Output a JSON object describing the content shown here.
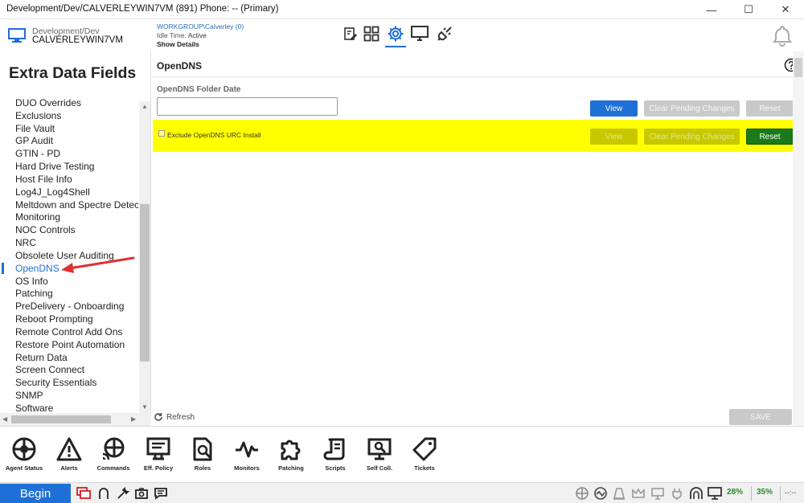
{
  "window": {
    "title": "Development/Dev/CALVERLEYWIN7VM (891) Phone: -- (Primary)",
    "minimize": "—",
    "maximize": "☐",
    "close": "✕"
  },
  "header": {
    "device_path": "Development/Dev",
    "device_name": "CALVERLEYWIN7VM",
    "workgroup": "WORKGROUP\\Calverley (0)",
    "idle_label": "Idle Time:",
    "idle_value": "Active",
    "show_details": "Show Details",
    "toolbar_icons": [
      "edit-list-icon",
      "grid-icon",
      "gear-icon",
      "monitor-icon",
      "plug-icon"
    ],
    "active_tool": "gear-icon"
  },
  "left_panel": {
    "heading": "Extra Data Fields",
    "items": [
      "DUO Overrides",
      "Exclusions",
      "File Vault",
      "GP Audit",
      "GTIN - PD",
      "Hard Drive Testing",
      "Host File Info",
      "Log4J_Log4Shell",
      "Meltdown and Spectre Detection",
      "Monitoring",
      "NOC Controls",
      "NRC",
      "Obsolete User Auditing",
      "OpenDNS",
      "OS Info",
      "Patching",
      "PreDelivery - Onboarding",
      "Reboot Prompting",
      "Remote Control Add Ons",
      "Restore Point Automation",
      "Return Data",
      "Screen Connect",
      "Security Essentials",
      "SNMP",
      "Software"
    ],
    "selected": "OpenDNS"
  },
  "main": {
    "title": "OpenDNS",
    "field_label": "OpenDNS Folder Date",
    "field_value": "",
    "row1": {
      "view": "View",
      "clear": "Clear Pending Changes",
      "reset": "Reset"
    },
    "checkbox_label": "Exclude OpenDNS URC Install",
    "row2": {
      "view": "View",
      "clear": "Clear Pending Changes",
      "reset": "Reset"
    },
    "refresh": "Refresh",
    "save": "SAVE"
  },
  "bottom_toolbar": [
    {
      "icon": "target-icon",
      "label": "Agent Status"
    },
    {
      "icon": "warning-icon",
      "label": "Alerts"
    },
    {
      "icon": "commands-icon",
      "label": "Commands"
    },
    {
      "icon": "policy-icon",
      "label": "Eff. Policy"
    },
    {
      "icon": "roles-icon",
      "label": "Roles"
    },
    {
      "icon": "pulse-icon",
      "label": "Monitors"
    },
    {
      "icon": "puzzle-icon",
      "label": "Patching"
    },
    {
      "icon": "scroll-icon",
      "label": "Scripts"
    },
    {
      "icon": "self-collect-icon",
      "label": "Self Coll."
    },
    {
      "icon": "tag-icon",
      "label": "Tickets"
    }
  ],
  "status_bar": {
    "begin": "Begin",
    "cpu": "28%",
    "memory": "35%",
    "clock": "--:--"
  },
  "colors": {
    "accent": "#1e6fd6",
    "highlight": "#ffff00",
    "reset_green": "#1a7a1a",
    "annotation_red": "#e03030"
  }
}
